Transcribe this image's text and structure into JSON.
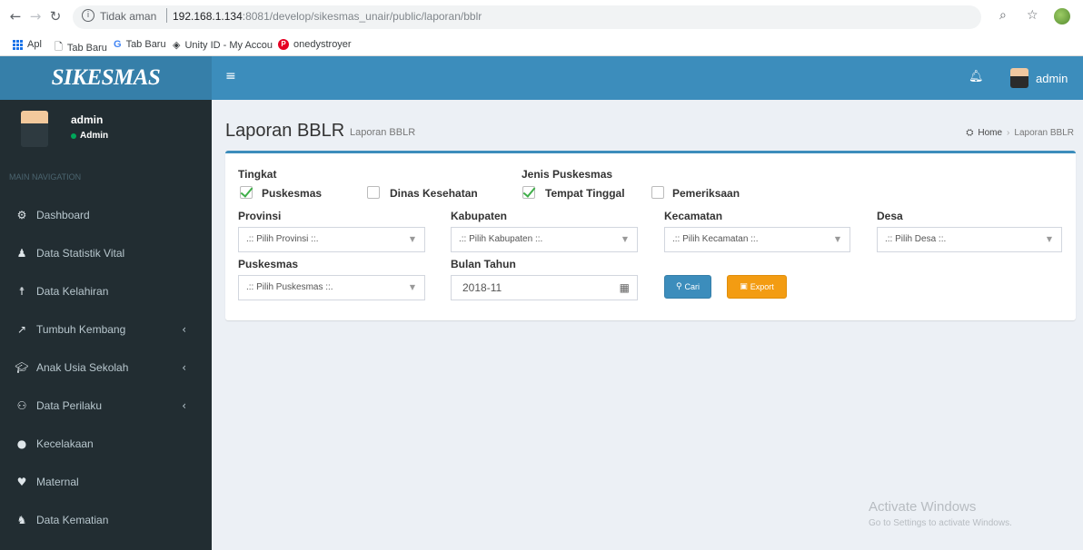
{
  "browser": {
    "security_label": "Tidak aman",
    "url_host": "192.168.1.134",
    "url_rest": ":8081/develop/sikesmas_unair/public/laporan/bblr",
    "bookmarks": [
      {
        "label": "Apl"
      },
      {
        "label": "Tab Baru"
      },
      {
        "label": "Tab Baru"
      },
      {
        "label": "Unity ID - My Accou"
      },
      {
        "label": "onedystroyer"
      }
    ]
  },
  "header": {
    "logo": "SIKESMAS",
    "user": "admin"
  },
  "sidebar": {
    "user_name": "admin",
    "user_role": "Admin",
    "nav_header": "MAIN NAVIGATION",
    "items": [
      {
        "label": "Dashboard",
        "icon": "dashboard-icon",
        "submenu": false
      },
      {
        "label": "Data Statistik Vital",
        "icon": "user-icon",
        "submenu": false
      },
      {
        "label": "Data Kelahiran",
        "icon": "child-icon",
        "submenu": false
      },
      {
        "label": "Tumbuh Kembang",
        "icon": "chart-icon",
        "submenu": true
      },
      {
        "label": "Anak Usia Sekolah",
        "icon": "graduation-icon",
        "submenu": true
      },
      {
        "label": "Data Perilaku",
        "icon": "binoculars-icon",
        "submenu": true
      },
      {
        "label": "Kecelakaan",
        "icon": "alert-icon",
        "submenu": false
      },
      {
        "label": "Maternal",
        "icon": "heartbeat-icon",
        "submenu": false
      },
      {
        "label": "Data Kematian",
        "icon": "users-icon",
        "submenu": false
      }
    ]
  },
  "page": {
    "title": "Laporan BBLR",
    "subtitle": "Laporan BBLR",
    "breadcrumb_home": "Home",
    "breadcrumb_current": "Laporan BBLR"
  },
  "form": {
    "tingkat_label": "Tingkat",
    "jenis_label": "Jenis Puskesmas",
    "cb_puskesmas": "Puskesmas",
    "cb_dinas": "Dinas Kesehatan",
    "cb_tempat": "Tempat Tinggal",
    "cb_pemeriksaan": "Pemeriksaan",
    "provinsi_label": "Provinsi",
    "provinsi_value": ".:: Pilih Provinsi ::.",
    "kabupaten_label": "Kabupaten",
    "kabupaten_value": ".:: Pilih Kabupaten ::.",
    "kecamatan_label": "Kecamatan",
    "kecamatan_value": ".:: Pilih Kecamatan ::.",
    "desa_label": "Desa",
    "desa_value": ".:: Pilih Desa ::.",
    "puskesmas_label": "Puskesmas",
    "puskesmas_value": ".:: Pilih Puskesmas ::.",
    "bulan_label": "Bulan Tahun",
    "bulan_value": "2018-11",
    "cari_label": "Cari",
    "export_label": "Export"
  },
  "watermark": {
    "line1": "Activate Windows",
    "line2": "Go to Settings to activate Windows."
  }
}
